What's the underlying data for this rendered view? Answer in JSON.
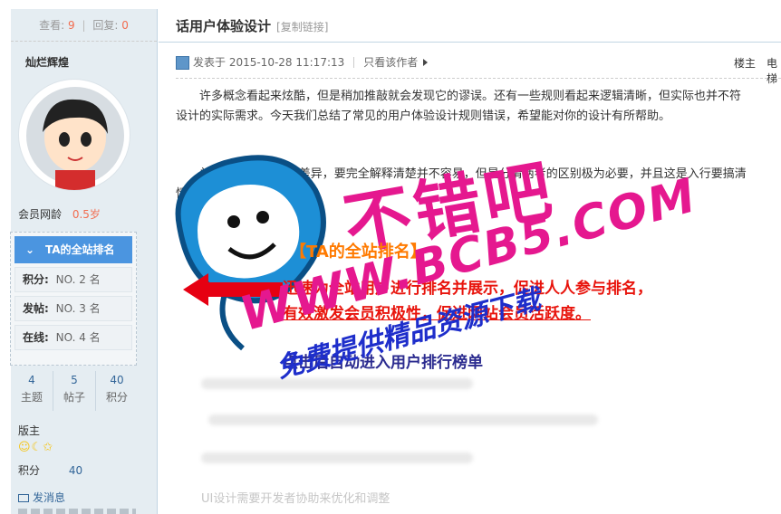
{
  "sidebar": {
    "views_label": "查看:",
    "views": "9",
    "replies_label": "回复:",
    "replies": "0",
    "author": "灿烂辉煌",
    "age_label": "会员网龄",
    "age_value": "0.5岁",
    "rank_button": "TA的全站排名",
    "rank_rows": [
      {
        "label": "积分:",
        "value": "NO. 2 名"
      },
      {
        "label": "发帖:",
        "value": "NO. 3 名"
      },
      {
        "label": "在线:",
        "value": "NO. 4 名"
      }
    ],
    "counters": [
      {
        "value": "4",
        "label": "主题"
      },
      {
        "value": "5",
        "label": "帖子"
      },
      {
        "value": "40",
        "label": "积分"
      }
    ],
    "role": "版主",
    "medals": "☺☾✩",
    "points_label": "积分",
    "points_value": "40",
    "message": "发消息"
  },
  "post": {
    "title": "话用户体验设计",
    "copy_link": "[复制链接]",
    "posted_label": "发表于 2015-10-28 11:17:13",
    "only_author": "只看该作者",
    "floor": "楼主",
    "floor_extra": "电梯",
    "para1_line1": "许多概念看起来炫酷，但是稍加推敲就会发现它的谬误。还有一些规则看起来逻辑清晰，但实际也并不符",
    "para1_line2": "设计的实际需求。今天我们总结了常见的用户体验设计规则错误，希望能对你的设计有所帮助。",
    "para2_line1": "关于UI和UX之间的差异，要完全解释清楚并不容易，但是分清两者的区别极为必要，并且这是入行要搞清",
    "para2_line2": "情。",
    "faint1": "UX设计(用户体验设计)",
    "faint2": "UI设计需要开发者协助来优化和调整"
  },
  "watermark": {
    "brand": "不错吧",
    "url": "WWW.BCB5.COM",
    "slogan": "免费提供精品资源下载",
    "promo_title": "【TA的全站排名】",
    "promo_line1": "迅速为全站用户进行排名并展示，促进人人参与排名，",
    "promo_line2": "有效激发会员积极性，促进网站会员活跃度。",
    "promo_link": "点击后自动进入用户排行榜单"
  },
  "colors": {
    "accent": "#4b95e0",
    "highlight": "#f26c4f",
    "watermark_pink": "#e5188f",
    "watermark_blue": "#1e2ecb",
    "promo_red": "#e8140c"
  }
}
